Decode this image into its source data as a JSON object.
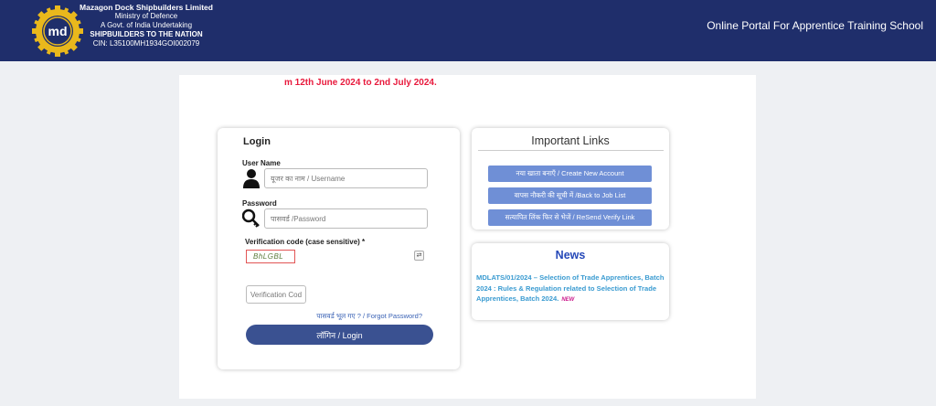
{
  "header": {
    "org_name": "Mazagon Dock Shipbuilders Limited",
    "ministry": "Ministry of Defence",
    "undertaking": "A Govt. of India Undertaking",
    "motto": "SHIPBUILDERS TO THE NATION",
    "cin": "CIN: L35100MH1934GOI002079",
    "portal_title": "Online Portal For Apprentice Training School",
    "logo_text": "md"
  },
  "marquee": {
    "text": "m 12th June 2024 to 2nd July 2024."
  },
  "login": {
    "title": "Login",
    "username_label": "User Name",
    "username_placeholder": "यूजर का नाम / Username",
    "password_label": "Password",
    "password_placeholder": "पासवर्ड /Password",
    "captcha_label": "Verification code (case sensitive) *",
    "captcha_text": "BhLGBL",
    "refresh_symbol": "⇄",
    "verify_placeholder": "Verification Cod",
    "forgot_text": "पासवर्ड भूल गए ? / Forgot Password?",
    "login_button": "लॉगिन / Login"
  },
  "important_links": {
    "title": "Important Links",
    "items": [
      "नया खाता बनाएँ / Create New Account",
      "वापस नौकरी की सूची में /Back to Job List",
      "सत्यापित लिंक फिर से भेजें / ReSend Verify Link"
    ]
  },
  "news": {
    "title": "News",
    "item": "MDLATS/01/2024 – Selection of Trade Apprentices, Batch 2024 : Rules & Regulation related to Selection of Trade Apprentices, Batch 2024.",
    "badge": "NEW"
  },
  "colors": {
    "header_bg": "#1f2e6b",
    "accent_red": "#e8193c",
    "login_button": "#3a5191",
    "link_button": "#6f8fd6",
    "news_title": "#2548b8",
    "news_text": "#3a9bd1"
  }
}
